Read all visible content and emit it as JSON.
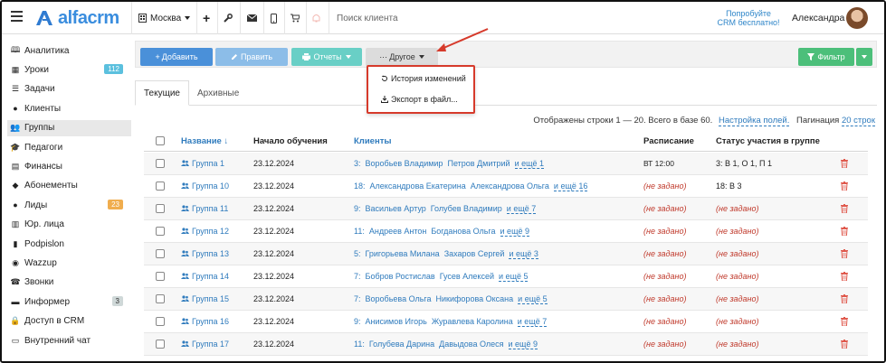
{
  "topbar": {
    "logo_text": "alfacrm",
    "city": "Москва",
    "search_placeholder": "Поиск клиента",
    "promo_line1": "Попробуйте",
    "promo_line2": "CRM бесплатно!",
    "user_name": "Александра"
  },
  "sidebar": {
    "items": [
      {
        "label": "Аналитика",
        "icon": "book-icon"
      },
      {
        "label": "Уроки",
        "icon": "calendar-icon",
        "badge": "112",
        "badge_color": "#5bc0de"
      },
      {
        "label": "Задачи",
        "icon": "tasks-icon"
      },
      {
        "label": "Клиенты",
        "icon": "user-icon"
      },
      {
        "label": "Группы",
        "icon": "users-icon",
        "active": true
      },
      {
        "label": "Педагоги",
        "icon": "graduation-cap-icon"
      },
      {
        "label": "Финансы",
        "icon": "money-icon"
      },
      {
        "label": "Абонементы",
        "icon": "tag-icon"
      },
      {
        "label": "Лиды",
        "icon": "user-add-icon",
        "badge": "23",
        "badge_color": "#f0ad4e"
      },
      {
        "label": "Юр. лица",
        "icon": "building-icon"
      },
      {
        "label": "Podpislon",
        "icon": "document-icon"
      },
      {
        "label": "Wazzup",
        "icon": "whatsapp-icon"
      },
      {
        "label": "Звонки",
        "icon": "phone-icon"
      },
      {
        "label": "Информер",
        "icon": "briefcase-icon",
        "badge": "3",
        "badge_color": "#cfd8d8"
      },
      {
        "label": "Доступ в CRM",
        "icon": "lock-icon"
      },
      {
        "label": "Внутренний чат",
        "icon": "chat-icon"
      }
    ]
  },
  "toolbar": {
    "add_label": "Добавить",
    "edit_label": "Править",
    "reports_label": "Отчеты",
    "other_label": "Другое",
    "filter_label": "Фильтр"
  },
  "dropdown": {
    "history_label": "История изменений",
    "export_label": "Экспорт в файл..."
  },
  "tabs": {
    "current": "Текущие",
    "archive": "Архивные"
  },
  "info": {
    "text": "Отображены строки 1 — 20. Всего в базе 60.",
    "settings_link": "Настройка полей.",
    "pagination_label": "Пагинация",
    "pagination_value": "20 строк"
  },
  "table": {
    "headers": {
      "name": "Название ↓",
      "start": "Начало обучения",
      "clients": "Клиенты",
      "schedule": "Расписание",
      "status": "Статус участия в группе"
    },
    "rows": [
      {
        "name": "Группа 1",
        "date": "23.12.2024",
        "count": "3:",
        "c1": "Воробьев Владимир",
        "c2": "Петров Дмитрий",
        "more": "и ещё 1",
        "schedule": "ВТ  12:00",
        "schedule_set": true,
        "status": "3:  В 1, О 1, П 1",
        "status_set": true
      },
      {
        "name": "Группа 10",
        "date": "23.12.2024",
        "count": "18:",
        "c1": "Александрова Екатерина",
        "c2": "Александрова Ольга",
        "more": "и ещё 16",
        "schedule": "(не задано)",
        "schedule_set": false,
        "status": "18:  В 3",
        "status_set": true
      },
      {
        "name": "Группа 11",
        "date": "23.12.2024",
        "count": "9:",
        "c1": "Васильев Артур",
        "c2": "Голубев Владимир",
        "more": "и ещё 7",
        "schedule": "(не задано)",
        "schedule_set": false,
        "status": "(не задано)",
        "status_set": false
      },
      {
        "name": "Группа 12",
        "date": "23.12.2024",
        "count": "11:",
        "c1": "Андреев Антон",
        "c2": "Богданова Ольга",
        "more": "и ещё 9",
        "schedule": "(не задано)",
        "schedule_set": false,
        "status": "(не задано)",
        "status_set": false
      },
      {
        "name": "Группа 13",
        "date": "23.12.2024",
        "count": "5:",
        "c1": "Григорьева Милана",
        "c2": "Захаров Сергей",
        "more": "и ещё 3",
        "schedule": "(не задано)",
        "schedule_set": false,
        "status": "(не задано)",
        "status_set": false
      },
      {
        "name": "Группа 14",
        "date": "23.12.2024",
        "count": "7:",
        "c1": "Бобров Ростислав",
        "c2": "Гусев Алексей",
        "more": "и ещё 5",
        "schedule": "(не задано)",
        "schedule_set": false,
        "status": "(не задано)",
        "status_set": false
      },
      {
        "name": "Группа 15",
        "date": "23.12.2024",
        "count": "7:",
        "c1": "Воробьева Ольга",
        "c2": "Никифорова Оксана",
        "more": "и ещё 5",
        "schedule": "(не задано)",
        "schedule_set": false,
        "status": "(не задано)",
        "status_set": false
      },
      {
        "name": "Группа 16",
        "date": "23.12.2024",
        "count": "9:",
        "c1": "Анисимов Игорь",
        "c2": "Журавлева Каролина",
        "more": "и ещё 7",
        "schedule": "(не задано)",
        "schedule_set": false,
        "status": "(не задано)",
        "status_set": false
      },
      {
        "name": "Группа 17",
        "date": "23.12.2024",
        "count": "11:",
        "c1": "Голубева Дарина",
        "c2": "Давыдова Олеся",
        "more": "и ещё 9",
        "schedule": "(не задано)",
        "schedule_set": false,
        "status": "(не задано)",
        "status_set": false
      }
    ]
  },
  "colors": {
    "primary": "#4a90d9",
    "edit": "#7fb6e6",
    "reports": "#5fc7bf",
    "other": "#d9d9d9",
    "filter": "#4cbf7a",
    "link": "#2f7bbd",
    "annotation": "#d63a2b",
    "danger": "#c0392b"
  }
}
